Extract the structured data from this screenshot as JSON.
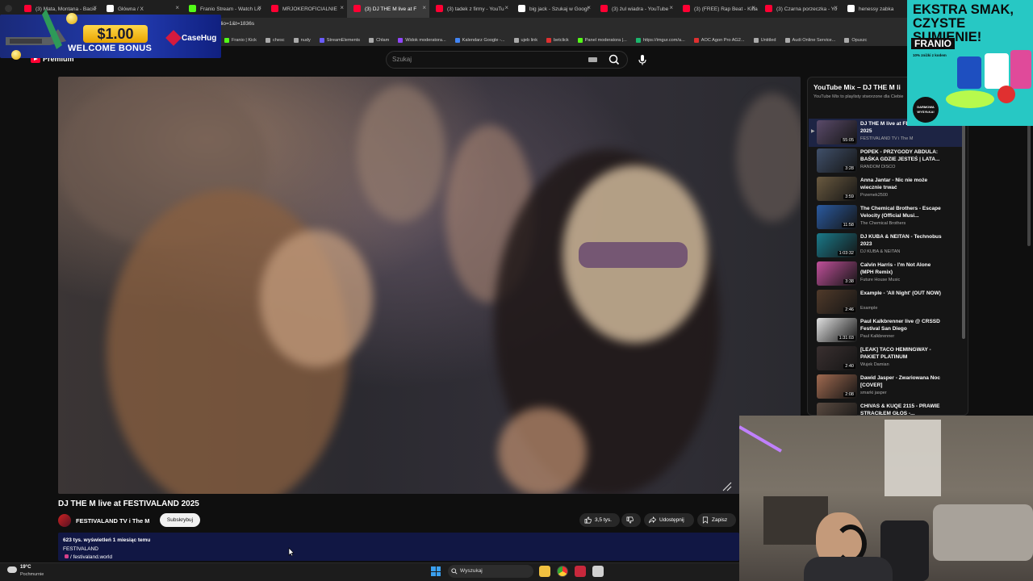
{
  "browser": {
    "tabs": [
      {
        "label": "(3) Mata, Montana - Bacie",
        "favicon_color": "#ff0033",
        "active": false
      },
      {
        "label": "Główna / X",
        "favicon_color": "#ffffff",
        "active": false
      },
      {
        "label": "Franio Stream - Watch Liv",
        "favicon_color": "#53fc18",
        "active": false
      },
      {
        "label": "MRJOKEROFICIALNIE",
        "favicon_color": "#ff0033",
        "active": false
      },
      {
        "label": "(3) DJ THE M live at F",
        "favicon_color": "#ff0033",
        "active": true
      },
      {
        "label": "(3) tadek z firmy - YouTu",
        "favicon_color": "#ff0033",
        "active": false
      },
      {
        "label": "big jack - Szukaj w Googl",
        "favicon_color": "#ffffff",
        "active": false
      },
      {
        "label": "(3) żul wiadra - YouTube",
        "favicon_color": "#ff0033",
        "active": false
      },
      {
        "label": "(3) (FREE) Rap Beat - Kilta",
        "favicon_color": "#ff0033",
        "active": false
      },
      {
        "label": "(3) Czarna porzeczka - Yo",
        "favicon_color": "#ff0033",
        "active": false
      },
      {
        "label": "henessy zabka",
        "favicon_color": "#ffffff",
        "active": false
      }
    ],
    "url_fragment": "rt_radio=1&t=1836s",
    "bookmarks": [
      {
        "label": "Franio | Kick",
        "icon_color": "#53fc18"
      },
      {
        "label": "chesc",
        "icon_color": "#aaaaaa"
      },
      {
        "label": "nudy",
        "icon_color": "#aaaaaa"
      },
      {
        "label": "StreamElements",
        "icon_color": "#6a5cff"
      },
      {
        "label": "Chłam",
        "icon_color": "#aaaaaa"
      },
      {
        "label": "Widok moderatora...",
        "icon_color": "#9146ff"
      },
      {
        "label": "Kalendarz Google -...",
        "icon_color": "#4285f4"
      },
      {
        "label": "ujeb link",
        "icon_color": "#aaaaaa"
      },
      {
        "label": "betclick",
        "icon_color": "#e03030"
      },
      {
        "label": "Panel moderatora |...",
        "icon_color": "#53fc18"
      },
      {
        "label": "https://imgur.com/a...",
        "icon_color": "#1bb76e"
      },
      {
        "label": "AOC Agon Pro AG2...",
        "icon_color": "#e03030"
      },
      {
        "label": "Untitled",
        "icon_color": "#aaaaaa"
      },
      {
        "label": "Audi Online Service...",
        "icon_color": "#aaaaaa"
      },
      {
        "label": "Opuszc",
        "icon_color": "#aaaaaa"
      }
    ]
  },
  "youtube": {
    "logo_label": "Premium",
    "search_placeholder": "Szukaj",
    "video": {
      "title": "DJ THE M live at FESTIVALAND 2025",
      "channel": "FESTIVALAND TV i The M",
      "subscribe_label": "Subskrybuj",
      "likes": "3,5 tys.",
      "share_label": "Udostępnij",
      "save_label": "Zapisz",
      "views_line": "623 tys. wyświetleń  1 miesiąc temu",
      "desc_line1": "FESTIVALAND",
      "desc_line2": "/ festivaland.world"
    },
    "playlist": {
      "title": "YouTube Mix – DJ THE M li",
      "subtitle": "YouTube Mix to playlisty stworzone dla Ciebie",
      "items": [
        {
          "title": "DJ THE M live at FESTIVALAND 2025",
          "channel": "FESTIVALAND TV i The M",
          "duration": "55:05",
          "current": true,
          "thumb": "#5a4a6a"
        },
        {
          "title": "POPEK - PRZYGODY ABDULA: BAŚKA GDZIE JESTEŚ | LATA...",
          "channel": "RANDOM DISCO",
          "duration": "3:28",
          "current": false,
          "thumb": "#40506a"
        },
        {
          "title": "Anna Jantar - Nic nie może wiecznie trwać",
          "channel": "Przemek2500",
          "duration": "3:59",
          "current": false,
          "thumb": "#6a5a40"
        },
        {
          "title": "The Chemical Brothers - Escape Velocity (Official Musi...",
          "channel": "The Chemical Brothers",
          "duration": "11:58",
          "current": false,
          "thumb": "#2a5aa0"
        },
        {
          "title": "DJ KUBA & NEITAN - Technobus 2023",
          "channel": "DJ KUBA & NEITAN",
          "duration": "1:03:32",
          "current": false,
          "thumb": "#1a7a8a"
        },
        {
          "title": "Calvin Harris - I'm Not Alone (MPH Remix)",
          "channel": "Future House Music",
          "duration": "3:38",
          "current": false,
          "thumb": "#c0509a"
        },
        {
          "title": "Example - 'All Night' (OUT NOW)",
          "channel": "Example",
          "duration": "2:46",
          "current": false,
          "thumb": "#503a2a"
        },
        {
          "title": "Paul Kalkbrenner live @ CRSSD Festival San Diego",
          "channel": "Paul Kalkbrenner",
          "duration": "1:31:03",
          "current": false,
          "thumb": "#e0e0e0"
        },
        {
          "title": "[LEAK] TACO HEMINGWAY - PAKIET PLATINUM",
          "channel": "Wujek Damian",
          "duration": "2:40",
          "current": false,
          "thumb": "#3a3030"
        },
        {
          "title": "Dawid Jasper - Zwariowana Noc [COVER]",
          "channel": "smarki jasper",
          "duration": "2:08",
          "current": false,
          "thumb": "#a06a50"
        },
        {
          "title": "CHIVAS & KUQE 2115 - PRAWIE STRACIŁEM GŁOS -...",
          "channel": "",
          "duration": "",
          "current": false,
          "thumb": "#5a4a40"
        }
      ]
    }
  },
  "ads": {
    "bonus": {
      "amount": "$1.00",
      "label": "WELCOME BONUS",
      "brand": "CaseHug"
    },
    "franio": {
      "headline": "EKSTRA SMAK, CZYSTE SUMIENIE!",
      "brand": "FRANIO",
      "tagline": "10% zniżki z kodem",
      "badge": "DARMOWA WYSYŁKA!"
    }
  },
  "taskbar": {
    "temperature": "19°C",
    "weather": "Pochmurnie",
    "search_label": "Wyszukaj"
  },
  "colors": {
    "accent": "#ff0033",
    "current_row": "#1d2444",
    "description_bg": "#111744"
  }
}
